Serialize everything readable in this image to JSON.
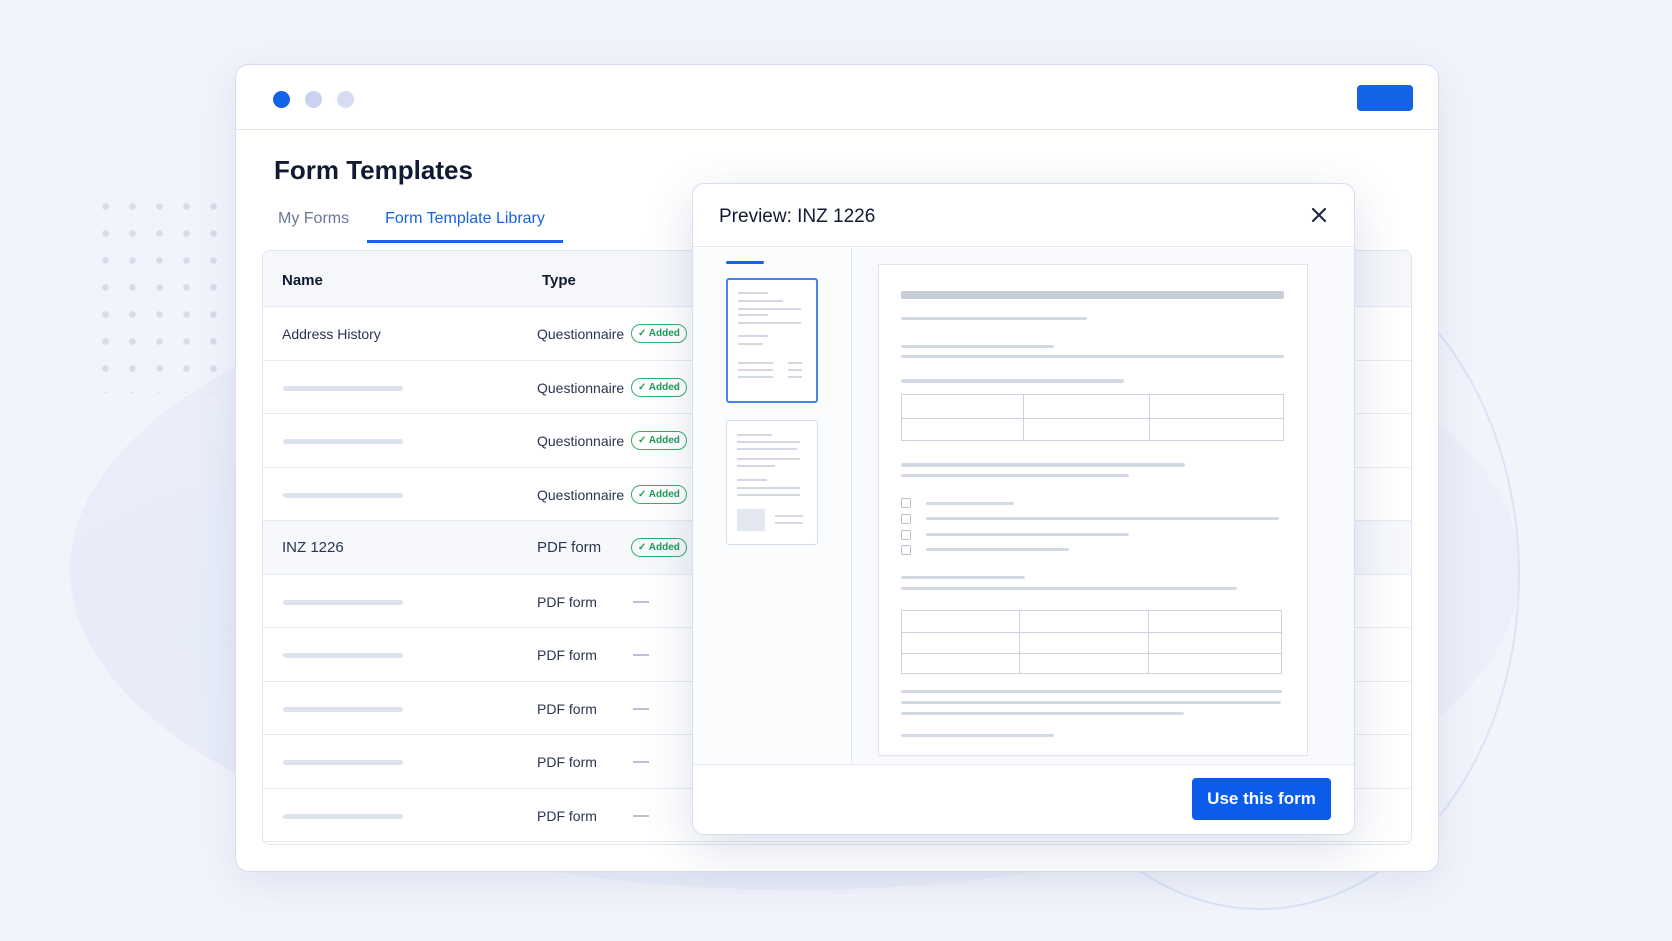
{
  "window": {
    "title": "Form Templates",
    "tabs": [
      {
        "label": "My Forms",
        "active": false
      },
      {
        "label": "Form Template Library",
        "active": true
      }
    ]
  },
  "table": {
    "columns": {
      "name": "Name",
      "type": "Type"
    },
    "rows": [
      {
        "name": "Address History",
        "type": "Questionnaire",
        "status": "✓ Added"
      },
      {
        "name": "",
        "type": "Questionnaire",
        "status": "✓ Added"
      },
      {
        "name": "",
        "type": "Questionnaire",
        "status": "✓ Added"
      },
      {
        "name": "",
        "type": "Questionnaire",
        "status": "✓ Added"
      },
      {
        "name": "INZ 1226",
        "type": "PDF form",
        "status": "✓ Added",
        "selected": true
      },
      {
        "name": "",
        "type": "PDF form",
        "status": "—"
      },
      {
        "name": "",
        "type": "PDF form",
        "status": "—"
      },
      {
        "name": "",
        "type": "PDF form",
        "status": "—"
      },
      {
        "name": "",
        "type": "PDF form",
        "status": "—"
      },
      {
        "name": "",
        "type": "PDF form",
        "status": "—"
      }
    ]
  },
  "preview": {
    "title": "Preview: INZ 1226",
    "close_icon": "close-icon",
    "use_button_label": "Use this form",
    "pages": 2,
    "active_page": 1
  },
  "colors": {
    "accent": "#1463e6",
    "badge_green": "#1f9a58",
    "background": "#f1f4fb"
  }
}
